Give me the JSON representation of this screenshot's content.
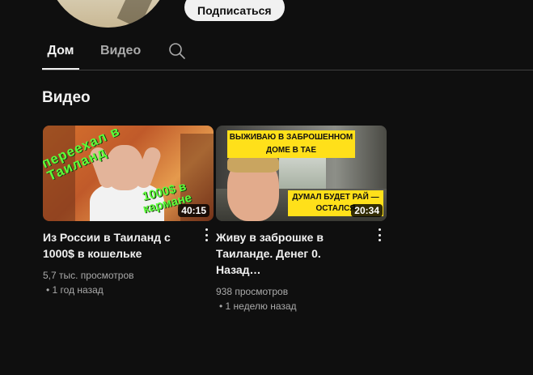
{
  "channel": {
    "subscribe_label": "Подписаться"
  },
  "tabs": [
    {
      "label": "Дом",
      "active": true
    },
    {
      "label": "Видео",
      "active": false
    }
  ],
  "section": {
    "title": "Видео"
  },
  "videos": [
    {
      "title": "Из России в Таиланд с 1000$ в кошельке",
      "duration": "40:15",
      "views": "5,7 тыс. просмотров",
      "age": "• 1 год назад",
      "thumb_text_top": "переехал в Таиланд",
      "thumb_text_bottom": "1000$ в кармане"
    },
    {
      "title": "Живу в заброшке в Таиланде. Денег 0. Назад…",
      "duration": "20:34",
      "views": "938 просмотров",
      "age": "• 1 неделю назад",
      "thumb_text_top_line1": "ВЫЖИВАЮ В ЗАБРОШЕННОМ",
      "thumb_text_top_line2": "ДОМЕ В ТАЕ",
      "thumb_text_bottom": "ДУМАЛ БУДЕТ РАЙ — ОСТАЛСЯ"
    }
  ],
  "colors": {
    "background": "#0f0f0f",
    "text_primary": "#f1f1f1",
    "text_secondary": "#aaaaaa",
    "thumb_caption_yellow": "#ffe01a",
    "thumb_caption_green": "#5cff3a"
  },
  "icons": {
    "search": "search-icon",
    "more": "more-vert-icon"
  }
}
